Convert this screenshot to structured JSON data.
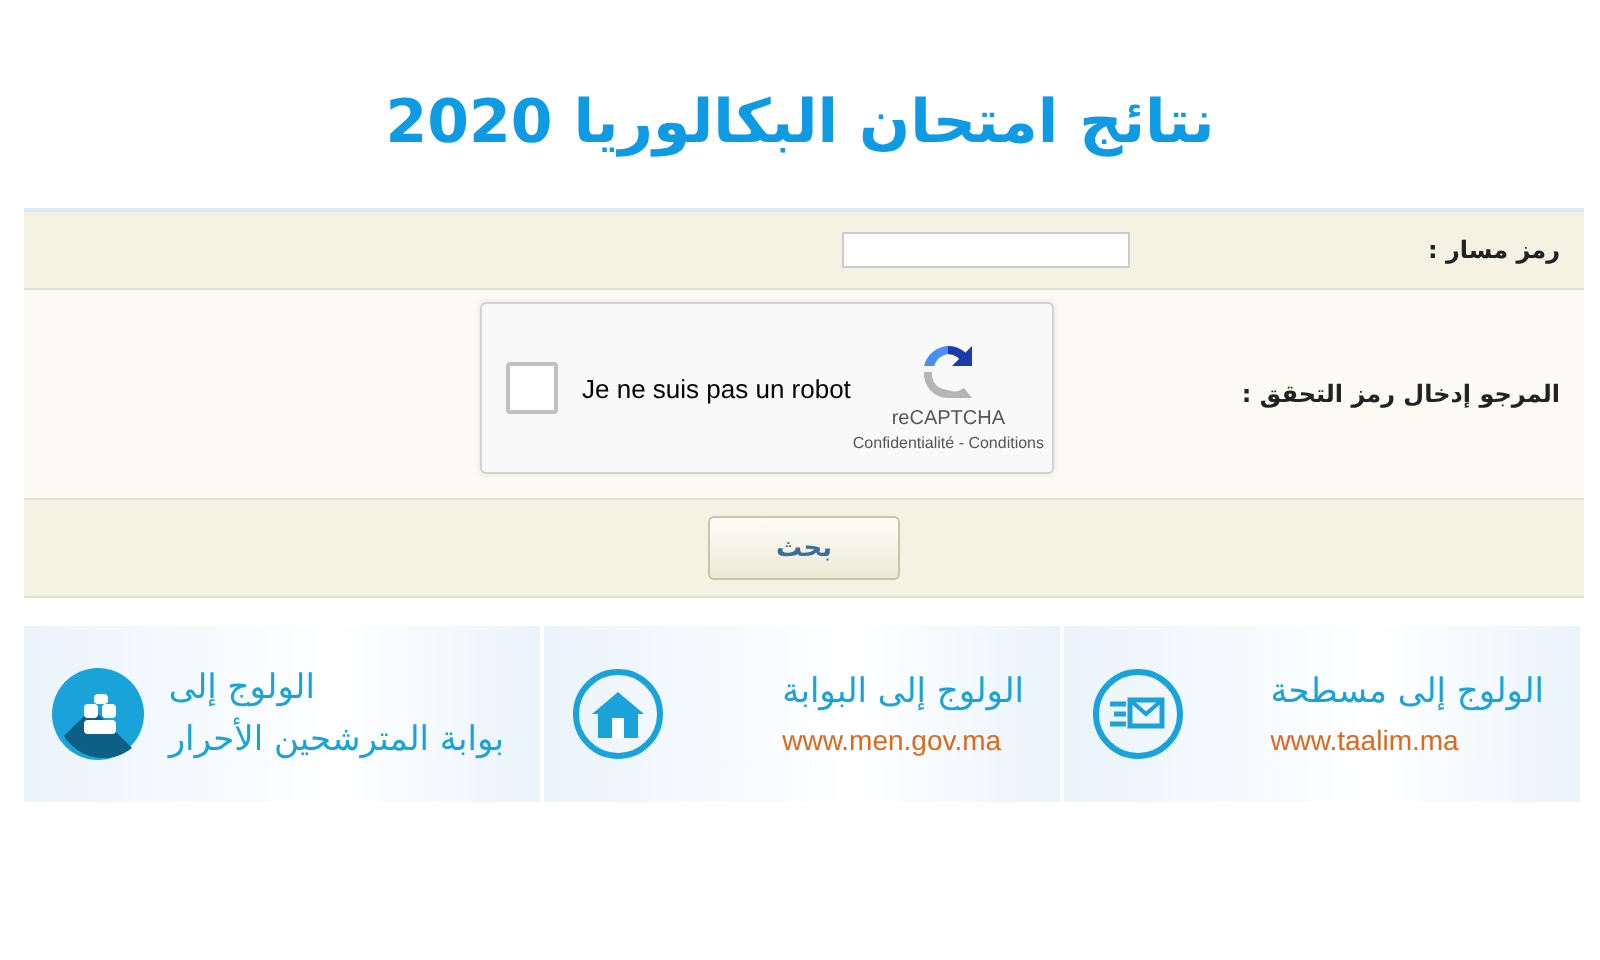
{
  "title": "نتائج امتحان البكالوريا 2020",
  "form": {
    "fields": [
      {
        "kind": "input",
        "label": "رمز مسار :"
      },
      {
        "kind": "captcha",
        "label": "المرجو إدخال رمز التحقق :"
      }
    ],
    "captcha": {
      "checked": false,
      "text": "Je ne suis pas un robot",
      "brand": "reCAPTCHA",
      "links": "Confidentialité - Conditions"
    },
    "submit": "بحث"
  },
  "banners": [
    {
      "kind": "mail",
      "lines": [
        {
          "kind": "heading",
          "text": "الولوج إلى مسطحة"
        },
        {
          "kind": "url",
          "text": "www.taalim.ma"
        }
      ]
    },
    {
      "kind": "home",
      "lines": [
        {
          "kind": "heading",
          "text": "الولوج إلى البوابة"
        },
        {
          "kind": "url",
          "text": "www.men.gov.ma"
        }
      ]
    },
    {
      "kind": "people",
      "lines": [
        {
          "kind": "heading",
          "text": "الولوج إلى"
        },
        {
          "kind": "heading",
          "text": "بوابة المترشحين الأحرار"
        }
      ]
    }
  ]
}
